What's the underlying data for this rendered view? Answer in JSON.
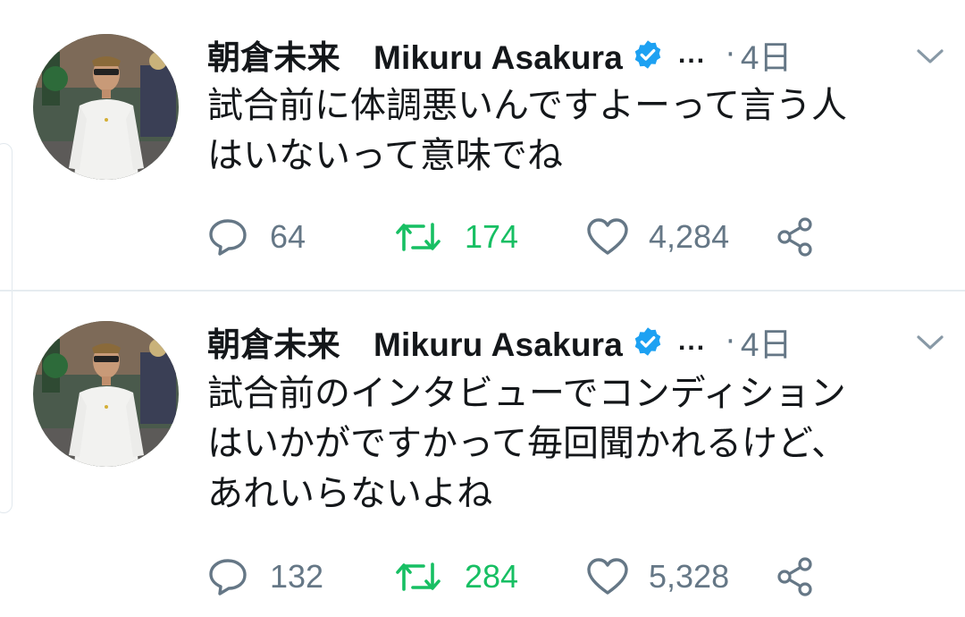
{
  "colors": {
    "text": "#14171a",
    "muted": "#657786",
    "verified_blue": "#1da1f2",
    "retweet_green": "#17bf63",
    "divider": "#e6ecf0"
  },
  "tweets": [
    {
      "author": {
        "name": "朝倉未来　Mikuru Asakura",
        "verified_icon": "verified-badge-icon",
        "truncation": "..."
      },
      "dot": "·",
      "time": "4日",
      "text_lines": [
        "試合前に体調悪いんですよーって言う人",
        "はいないって意味でね"
      ],
      "stats": {
        "replies": "64",
        "retweets": "174",
        "likes": "4,284"
      }
    },
    {
      "author": {
        "name": "朝倉未来　Mikuru Asakura",
        "verified_icon": "verified-badge-icon",
        "truncation": "..."
      },
      "dot": "·",
      "time": "4日",
      "text_lines": [
        "試合前のインタビューでコンディション",
        "はいかがですかって毎回聞かれるけど、",
        "あれいらないよね"
      ],
      "stats": {
        "replies": "132",
        "retweets": "284",
        "likes": "5,328"
      }
    }
  ]
}
